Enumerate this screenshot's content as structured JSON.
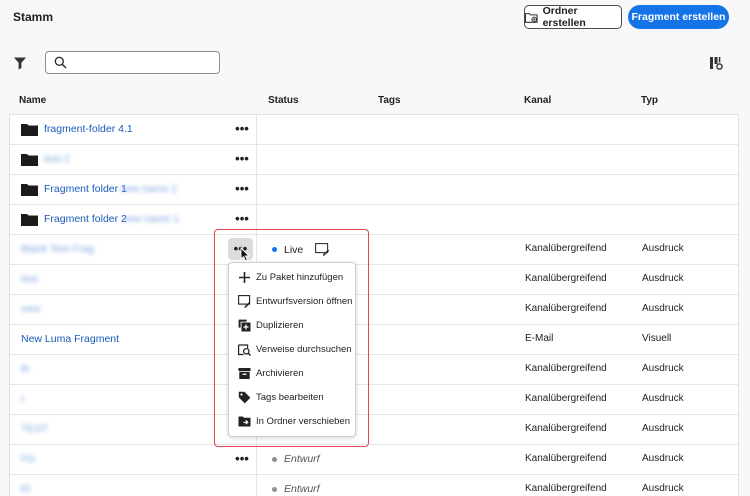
{
  "header": {
    "title": "Stamm",
    "create_folder_label": "Ordner erstellen",
    "create_fragment_label": "Fragment erstellen"
  },
  "search": {
    "value": "",
    "placeholder": ""
  },
  "columns": {
    "name": "Name",
    "status": "Status",
    "tags": "Tags",
    "channel": "Kanal",
    "type": "Typ"
  },
  "rows": [
    {
      "name": "fragment-folder 4.1",
      "suffix": "",
      "kind": "folder"
    },
    {
      "name": "",
      "suffix": "test 2",
      "kind": "folder"
    },
    {
      "name": "Fragment folder 1",
      "suffix": "new name 2",
      "kind": "folder"
    },
    {
      "name": "Fragment folder 2",
      "suffix": "new name 1",
      "kind": "folder"
    },
    {
      "name": "Blank Test Frag",
      "blurred": true,
      "status": "Live",
      "channel": "Kanalübergreifend",
      "type": "Ausdruck"
    },
    {
      "name": "test",
      "blurred": true,
      "channel": "Kanalübergreifend",
      "type": "Ausdruck"
    },
    {
      "name": "new",
      "blurred": true,
      "channel": "Kanalübergreifend",
      "type": "Ausdruck"
    },
    {
      "name": "New Luma Fragment",
      "channel": "E-Mail",
      "type": "Visuell"
    },
    {
      "name": "th",
      "blurred": true,
      "channel": "Kanalübergreifend",
      "type": "Ausdruck"
    },
    {
      "name": "t",
      "blurred": true,
      "channel": "Kanalübergreifend",
      "type": "Ausdruck"
    },
    {
      "name": "TEST",
      "blurred": true,
      "channel": "Kanalübergreifend",
      "type": "Ausdruck"
    },
    {
      "name": "FG",
      "blurred": true,
      "status": "Entwurf",
      "channel": "Kanalübergreifend",
      "type": "Ausdruck"
    },
    {
      "name": "Kl",
      "blurred": true,
      "status": "Entwurf",
      "channel": "Kanalübergreifend",
      "type": "Ausdruck"
    }
  ],
  "context_menu": {
    "items": [
      {
        "label": "Zu Paket hinzufügen",
        "icon": "plus-icon"
      },
      {
        "label": "Entwurfsversion öffnen",
        "icon": "draft-edit-icon"
      },
      {
        "label": "Duplizieren",
        "icon": "duplicate-icon"
      },
      {
        "label": "Verweise durchsuchen",
        "icon": "search-references-icon"
      },
      {
        "label": "Archivieren",
        "icon": "archive-icon"
      },
      {
        "label": "Tags bearbeiten",
        "icon": "tag-icon"
      },
      {
        "label": "In Ordner verschieben",
        "icon": "move-folder-icon"
      }
    ]
  },
  "colors": {
    "primary": "#1473e6",
    "live": "#1473e6",
    "draft": "#8e8e8e",
    "highlight": "#e34850",
    "link": "#1a5ab8"
  }
}
